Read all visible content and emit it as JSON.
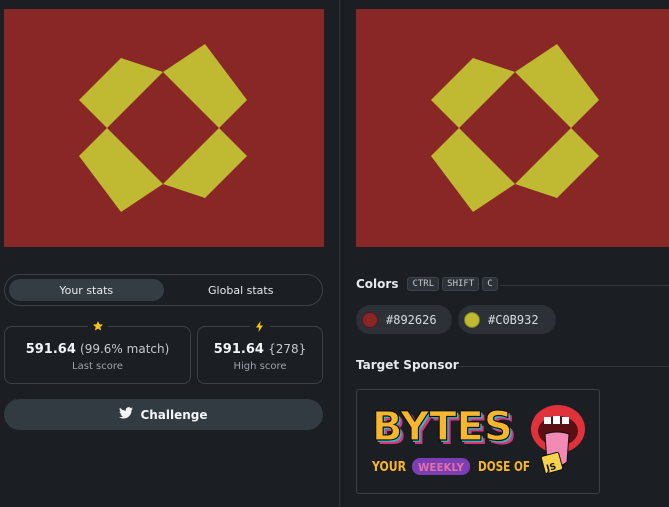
{
  "canvases": {
    "background_color": "#892626",
    "shape_color": "#C0B932"
  },
  "stats_tabs": {
    "your_label": "Your stats",
    "global_label": "Global stats"
  },
  "last_score": {
    "score": "591.64",
    "match": "(99.6% match)",
    "caption": "Last score",
    "icon": "star-icon"
  },
  "high_score": {
    "score": "591.64",
    "rank": "{278}",
    "caption": "High score",
    "icon": "lightning-icon"
  },
  "challenge_button": {
    "label": "Challenge",
    "icon": "twitter-icon"
  },
  "colors": {
    "title": "Colors",
    "shortcut_keys": [
      "CTRL",
      "SHIFT",
      "C"
    ],
    "swatches": [
      {
        "hex": "#892626",
        "label": "#892626"
      },
      {
        "hex": "#C0B932",
        "label": "#C0B932"
      }
    ]
  },
  "sponsor": {
    "title": "Target Sponsor",
    "logo_text": "BYTES",
    "tagline_your": "YOUR",
    "tagline_weekly": "WEEKLY",
    "tagline_dose": "DOSE OF",
    "badge_text": "JS"
  }
}
